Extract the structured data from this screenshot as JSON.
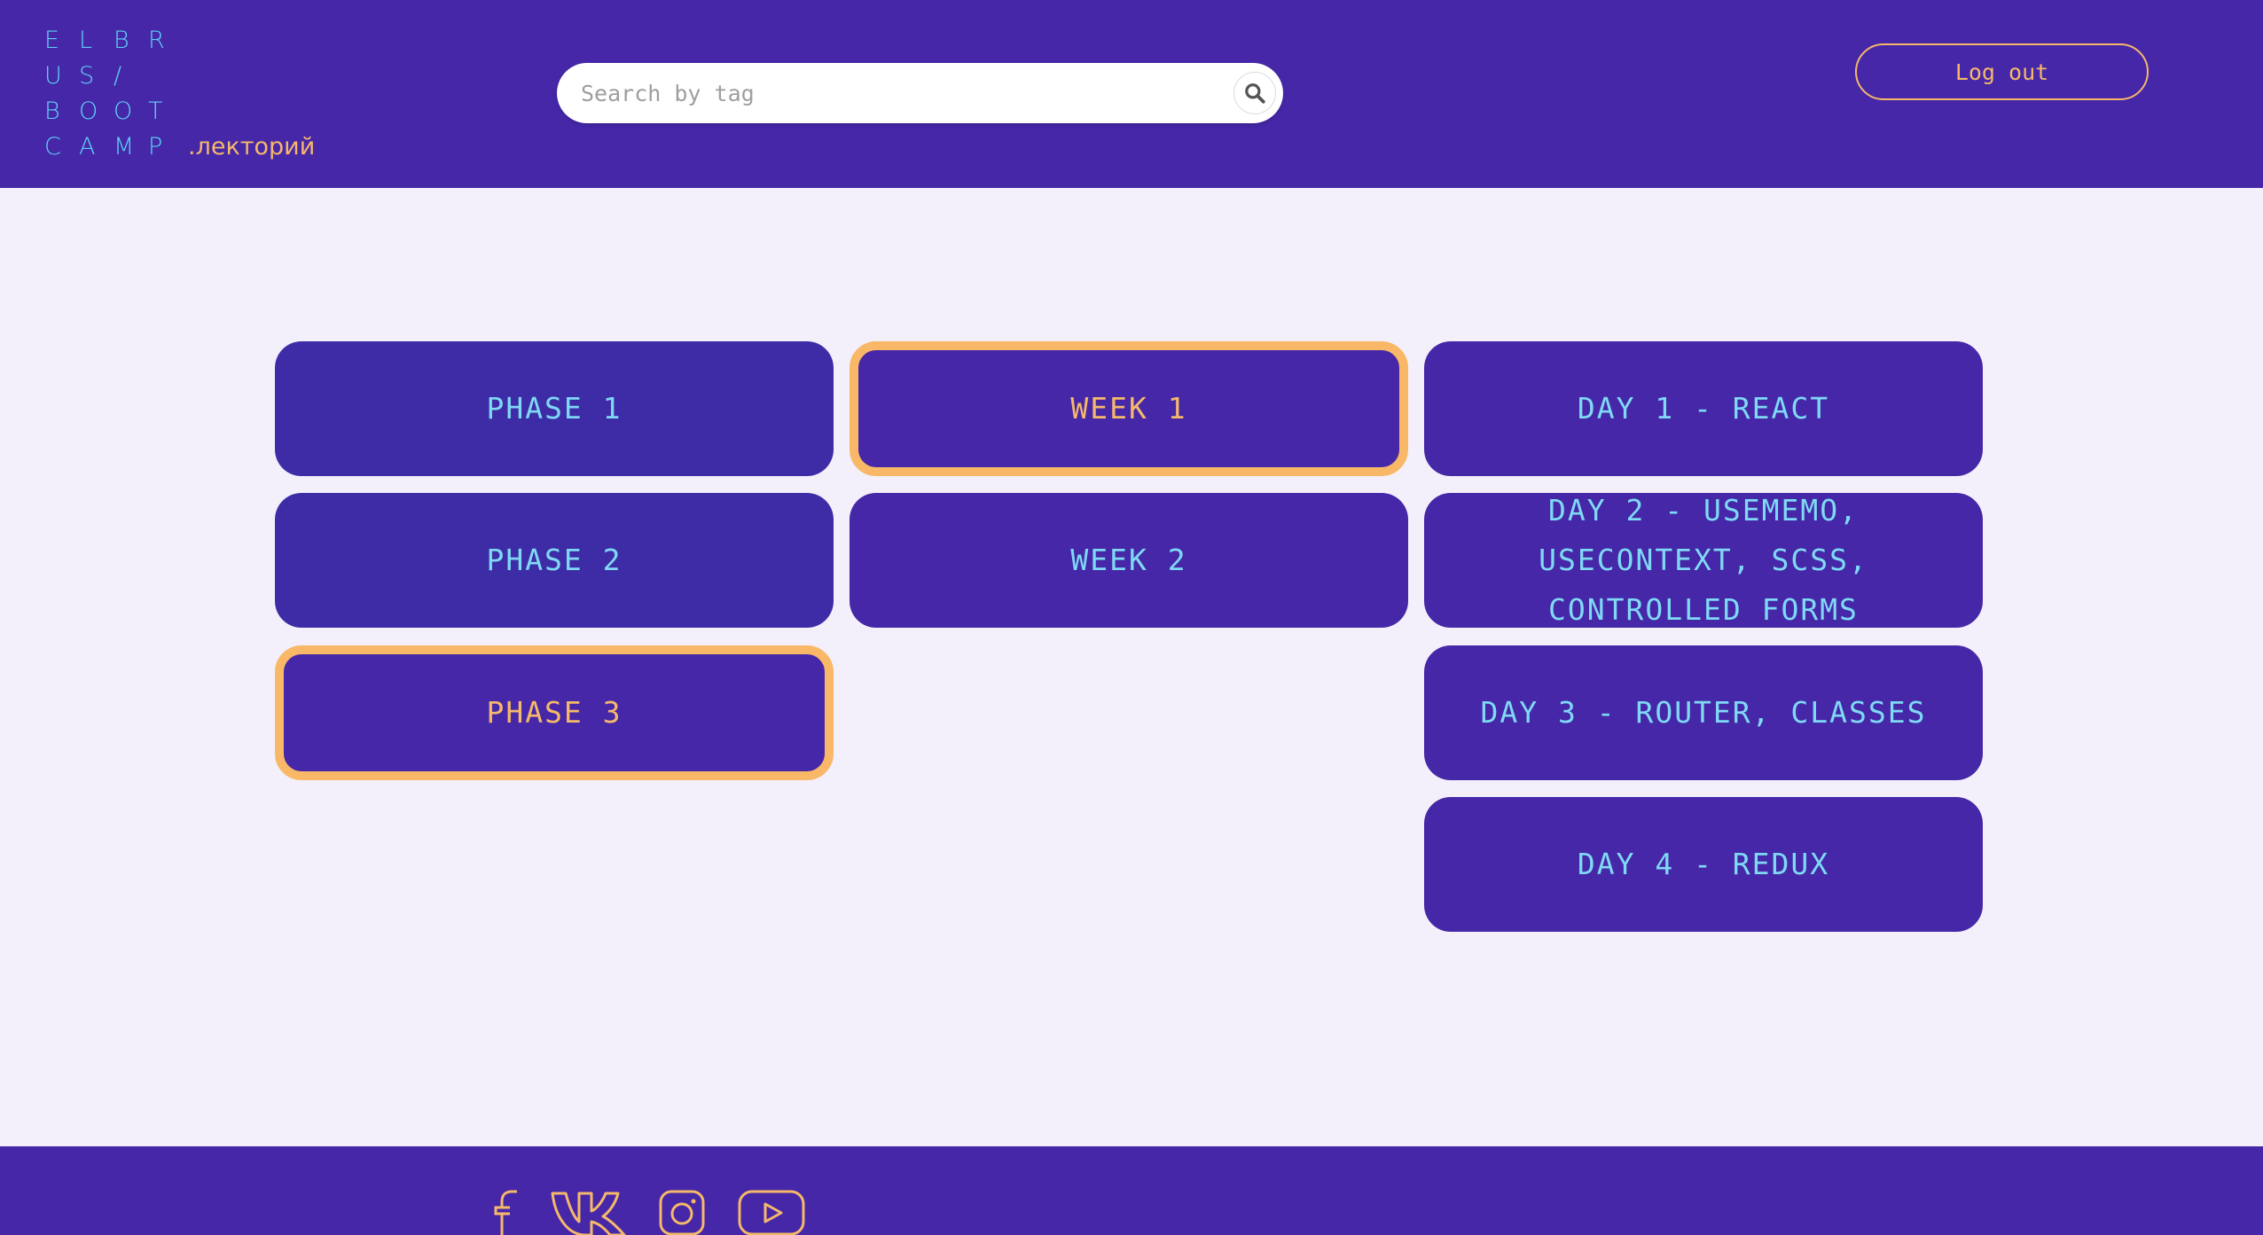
{
  "logo": {
    "rows": [
      [
        "E",
        "L",
        "B",
        "R"
      ],
      [
        "U",
        "S",
        "/"
      ],
      [
        "B",
        "O",
        "O",
        "T"
      ],
      [
        "C",
        "A",
        "M",
        "P"
      ]
    ],
    "suffix": ".лекторий"
  },
  "search": {
    "placeholder": "Search by tag",
    "icon": "search-icon"
  },
  "header": {
    "logout_label": "Log out"
  },
  "phases": [
    {
      "label": "PHASE 1",
      "selected": false
    },
    {
      "label": "PHASE 2",
      "selected": false
    },
    {
      "label": "PHASE 3",
      "selected": true
    }
  ],
  "weeks": [
    {
      "label": "WEEK 1",
      "selected": true
    },
    {
      "label": "WEEK 2",
      "selected": false
    }
  ],
  "days": [
    {
      "label": "DAY 1 - REACT"
    },
    {
      "label": "DAY 2 - USEMEMO, USECONTEXT, SCSS, CONTROLLED FORMS"
    },
    {
      "label": "DAY 3 - ROUTER, CLASSES"
    },
    {
      "label": "DAY 4 - REDUX"
    }
  ],
  "footer": {
    "social_icons": [
      "facebook-icon",
      "vk-icon",
      "instagram-icon",
      "youtube-icon"
    ]
  },
  "colors": {
    "primary": "#4527a8",
    "accent": "#f6b86a",
    "text_cyan": "#7fd9f5",
    "background": "#f3f0fb"
  }
}
